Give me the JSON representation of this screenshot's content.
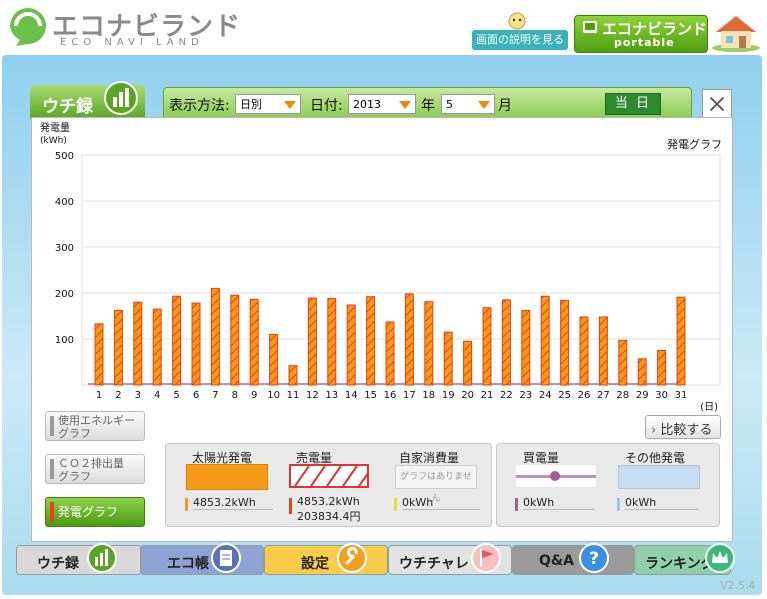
{
  "header": {
    "logo_text": "エコナビランド",
    "logo_sub": "ECO NAVI LAND",
    "help_button": "画面の説明を見る",
    "portable_title": "エコナビランド",
    "portable_sub": "portable"
  },
  "tab": {
    "label": "ウチ録"
  },
  "controls": {
    "display_label": "表示方法:",
    "display_value": "日別",
    "date_label": "日付:",
    "year_value": "2013",
    "year_unit": "年",
    "month_value": "5",
    "month_unit": "月",
    "today_button": "当 日"
  },
  "chart_data": {
    "type": "bar",
    "title": "発電グラフ",
    "ylabel": "発電量",
    "yunit": "(kWh)",
    "xunit": "(日)",
    "ylim": [
      0,
      500
    ],
    "yticks": [
      "500",
      "400",
      "300",
      "200",
      "100"
    ],
    "categories": [
      "1",
      "2",
      "3",
      "4",
      "5",
      "6",
      "7",
      "8",
      "9",
      "10",
      "11",
      "12",
      "13",
      "14",
      "15",
      "16",
      "17",
      "18",
      "19",
      "20",
      "21",
      "22",
      "23",
      "24",
      "25",
      "26",
      "27",
      "28",
      "29",
      "30",
      "31"
    ],
    "series": [
      {
        "values": [
          133,
          162,
          180,
          165,
          193,
          178,
          210,
          195,
          186,
          110,
          42,
          189,
          188,
          174,
          192,
          137,
          198,
          181,
          115,
          95,
          168,
          185,
          162,
          193,
          184,
          148,
          148,
          97,
          57,
          75,
          191
        ]
      }
    ],
    "colors": {
      "bar_fill": "#f79a1a",
      "bar_stroke": "#e84010",
      "hatch": "#e84010",
      "baseline": "#c78bbd"
    }
  },
  "left_buttons": [
    {
      "label": "使用エネルギー\nグラフ"
    },
    {
      "label": "ＣＯ２排出量\nグラフ"
    },
    {
      "label": "発電グラフ"
    }
  ],
  "compare_button": "比較する",
  "legend": {
    "solar": {
      "title": "太陽光発電",
      "value": "4853.2kWh"
    },
    "sold": {
      "title": "売電量",
      "value": "4853.2kWh",
      "value2": "203834.4円"
    },
    "self": {
      "title": "自家消費量",
      "value": "0kWh",
      "placeholder": "グラフはありません"
    },
    "bought": {
      "title": "買電量",
      "value": "0kWh"
    },
    "other": {
      "title": "その他発電",
      "value": "0kWh"
    }
  },
  "nav": [
    {
      "label": "ウチ録",
      "color": "#d8d8d8"
    },
    {
      "label": "エコ帳",
      "color": "#8ea3d4"
    },
    {
      "label": "設定",
      "color": "#f8cb4a"
    },
    {
      "label": "ウチチャレ",
      "color": "#e2e2e2"
    },
    {
      "label": "Q&A",
      "color": "#9a9a9a"
    },
    {
      "label": "ランキング",
      "color": "#8fd0a8"
    }
  ],
  "version": "V2.5.4"
}
